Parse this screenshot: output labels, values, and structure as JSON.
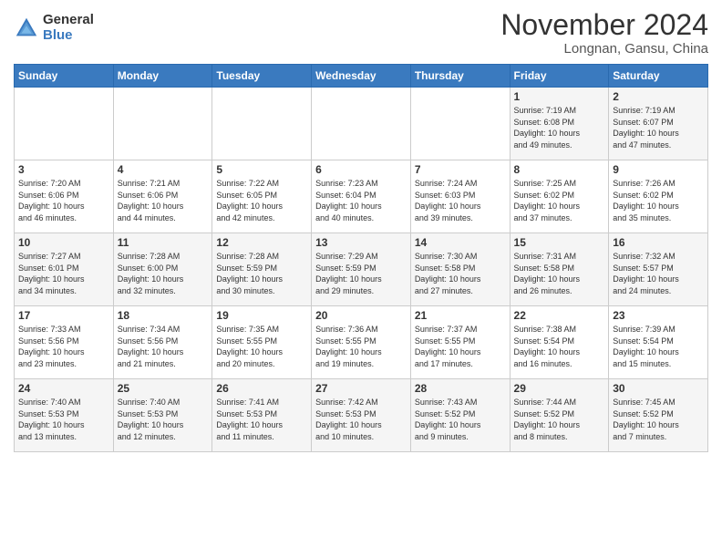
{
  "header": {
    "logo_general": "General",
    "logo_blue": "Blue",
    "month_title": "November 2024",
    "location": "Longnan, Gansu, China"
  },
  "calendar": {
    "days_of_week": [
      "Sunday",
      "Monday",
      "Tuesday",
      "Wednesday",
      "Thursday",
      "Friday",
      "Saturday"
    ],
    "weeks": [
      [
        {
          "day": "",
          "info": ""
        },
        {
          "day": "",
          "info": ""
        },
        {
          "day": "",
          "info": ""
        },
        {
          "day": "",
          "info": ""
        },
        {
          "day": "",
          "info": ""
        },
        {
          "day": "1",
          "info": "Sunrise: 7:19 AM\nSunset: 6:08 PM\nDaylight: 10 hours\nand 49 minutes."
        },
        {
          "day": "2",
          "info": "Sunrise: 7:19 AM\nSunset: 6:07 PM\nDaylight: 10 hours\nand 47 minutes."
        }
      ],
      [
        {
          "day": "3",
          "info": "Sunrise: 7:20 AM\nSunset: 6:06 PM\nDaylight: 10 hours\nand 46 minutes."
        },
        {
          "day": "4",
          "info": "Sunrise: 7:21 AM\nSunset: 6:06 PM\nDaylight: 10 hours\nand 44 minutes."
        },
        {
          "day": "5",
          "info": "Sunrise: 7:22 AM\nSunset: 6:05 PM\nDaylight: 10 hours\nand 42 minutes."
        },
        {
          "day": "6",
          "info": "Sunrise: 7:23 AM\nSunset: 6:04 PM\nDaylight: 10 hours\nand 40 minutes."
        },
        {
          "day": "7",
          "info": "Sunrise: 7:24 AM\nSunset: 6:03 PM\nDaylight: 10 hours\nand 39 minutes."
        },
        {
          "day": "8",
          "info": "Sunrise: 7:25 AM\nSunset: 6:02 PM\nDaylight: 10 hours\nand 37 minutes."
        },
        {
          "day": "9",
          "info": "Sunrise: 7:26 AM\nSunset: 6:02 PM\nDaylight: 10 hours\nand 35 minutes."
        }
      ],
      [
        {
          "day": "10",
          "info": "Sunrise: 7:27 AM\nSunset: 6:01 PM\nDaylight: 10 hours\nand 34 minutes."
        },
        {
          "day": "11",
          "info": "Sunrise: 7:28 AM\nSunset: 6:00 PM\nDaylight: 10 hours\nand 32 minutes."
        },
        {
          "day": "12",
          "info": "Sunrise: 7:28 AM\nSunset: 5:59 PM\nDaylight: 10 hours\nand 30 minutes."
        },
        {
          "day": "13",
          "info": "Sunrise: 7:29 AM\nSunset: 5:59 PM\nDaylight: 10 hours\nand 29 minutes."
        },
        {
          "day": "14",
          "info": "Sunrise: 7:30 AM\nSunset: 5:58 PM\nDaylight: 10 hours\nand 27 minutes."
        },
        {
          "day": "15",
          "info": "Sunrise: 7:31 AM\nSunset: 5:58 PM\nDaylight: 10 hours\nand 26 minutes."
        },
        {
          "day": "16",
          "info": "Sunrise: 7:32 AM\nSunset: 5:57 PM\nDaylight: 10 hours\nand 24 minutes."
        }
      ],
      [
        {
          "day": "17",
          "info": "Sunrise: 7:33 AM\nSunset: 5:56 PM\nDaylight: 10 hours\nand 23 minutes."
        },
        {
          "day": "18",
          "info": "Sunrise: 7:34 AM\nSunset: 5:56 PM\nDaylight: 10 hours\nand 21 minutes."
        },
        {
          "day": "19",
          "info": "Sunrise: 7:35 AM\nSunset: 5:55 PM\nDaylight: 10 hours\nand 20 minutes."
        },
        {
          "day": "20",
          "info": "Sunrise: 7:36 AM\nSunset: 5:55 PM\nDaylight: 10 hours\nand 19 minutes."
        },
        {
          "day": "21",
          "info": "Sunrise: 7:37 AM\nSunset: 5:55 PM\nDaylight: 10 hours\nand 17 minutes."
        },
        {
          "day": "22",
          "info": "Sunrise: 7:38 AM\nSunset: 5:54 PM\nDaylight: 10 hours\nand 16 minutes."
        },
        {
          "day": "23",
          "info": "Sunrise: 7:39 AM\nSunset: 5:54 PM\nDaylight: 10 hours\nand 15 minutes."
        }
      ],
      [
        {
          "day": "24",
          "info": "Sunrise: 7:40 AM\nSunset: 5:53 PM\nDaylight: 10 hours\nand 13 minutes."
        },
        {
          "day": "25",
          "info": "Sunrise: 7:40 AM\nSunset: 5:53 PM\nDaylight: 10 hours\nand 12 minutes."
        },
        {
          "day": "26",
          "info": "Sunrise: 7:41 AM\nSunset: 5:53 PM\nDaylight: 10 hours\nand 11 minutes."
        },
        {
          "day": "27",
          "info": "Sunrise: 7:42 AM\nSunset: 5:53 PM\nDaylight: 10 hours\nand 10 minutes."
        },
        {
          "day": "28",
          "info": "Sunrise: 7:43 AM\nSunset: 5:52 PM\nDaylight: 10 hours\nand 9 minutes."
        },
        {
          "day": "29",
          "info": "Sunrise: 7:44 AM\nSunset: 5:52 PM\nDaylight: 10 hours\nand 8 minutes."
        },
        {
          "day": "30",
          "info": "Sunrise: 7:45 AM\nSunset: 5:52 PM\nDaylight: 10 hours\nand 7 minutes."
        }
      ]
    ]
  }
}
